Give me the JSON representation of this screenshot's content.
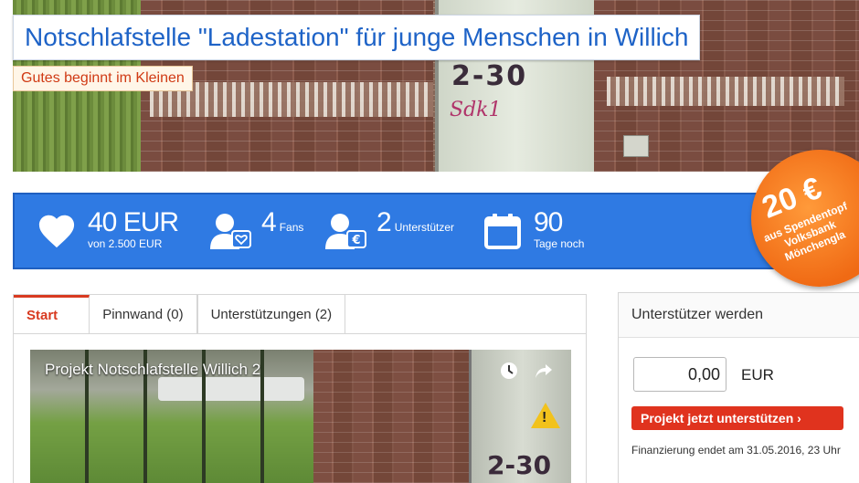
{
  "project": {
    "title": "Notschlafstelle \"Ladestation\" für junge Menschen in Willich",
    "tagline": "Gutes beginnt im Kleinen"
  },
  "stats": {
    "amount": {
      "value": "40 EUR",
      "sub": "von 2.500 EUR"
    },
    "fans": {
      "value": "4",
      "sub": "Fans"
    },
    "supporters": {
      "value": "2",
      "sub": "Unterstützer"
    },
    "days": {
      "value": "90",
      "sub": "Tage noch"
    }
  },
  "promo": {
    "amount": "20 €",
    "text": "aus Spendentopf Volksbank Mönchengla"
  },
  "tabs": [
    {
      "label": "Start",
      "active": true
    },
    {
      "label": "Pinnwand (0)",
      "active": false
    },
    {
      "label": "Unterstützungen (2)",
      "active": false
    }
  ],
  "video": {
    "title": "Projekt Notschlafstelle Willich 2",
    "icons": [
      "clock-icon",
      "share-icon"
    ]
  },
  "sidebar": {
    "heading": "Unterstützer werden",
    "amount_value": "0,00",
    "currency": "EUR",
    "support_button": "Projekt jetzt unterstützen ›",
    "funding_note": "Finanzierung endet am 31.05.2016, 23 Uhr"
  },
  "colors": {
    "brand_blue": "#2f7ae3",
    "title_blue": "#1e63c7",
    "accent_red": "#e0331e",
    "promo_orange": "#f06a14"
  }
}
